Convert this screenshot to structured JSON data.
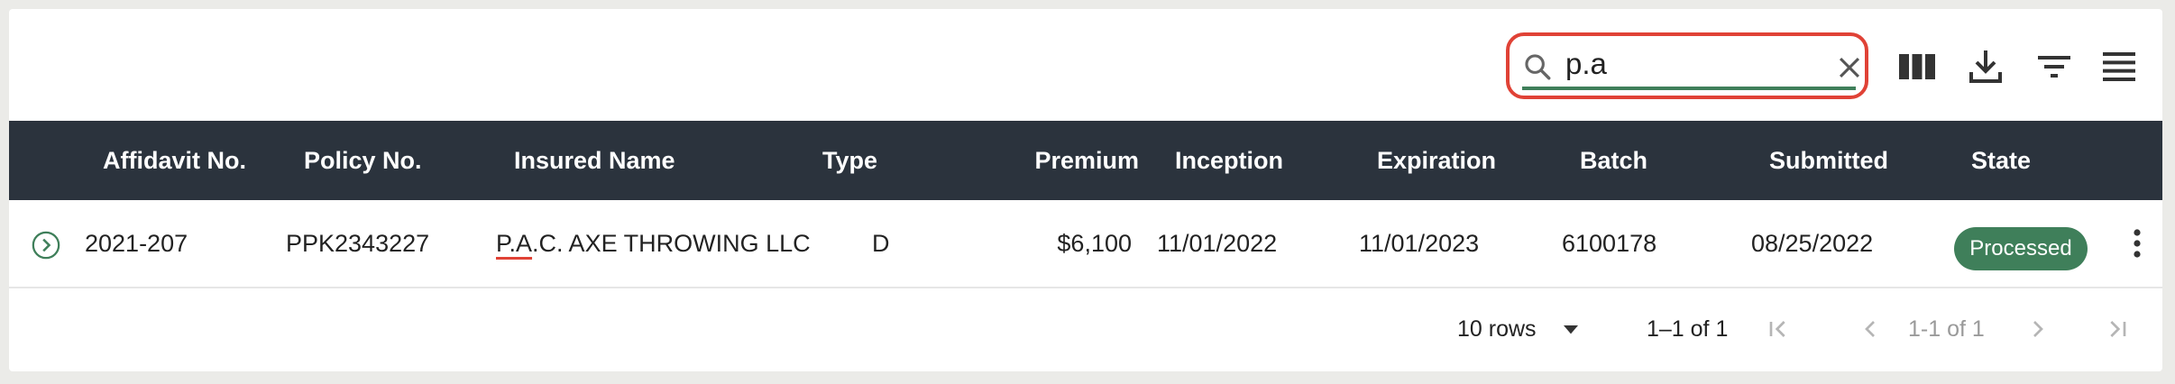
{
  "toolbar": {
    "search_value": "p.a",
    "search_icon": "search-icon",
    "clear_icon": "close-icon",
    "columns_icon": "columns-icon",
    "download_icon": "download-icon",
    "filter_icon": "filter-icon",
    "density_icon": "density-icon"
  },
  "table": {
    "headers": [
      "Affidavit No.",
      "Policy No.",
      "Insured Name",
      "Type",
      "Premium",
      "Inception",
      "Expiration",
      "Batch",
      "Submitted",
      "State"
    ],
    "rows": [
      {
        "affidavit": "2021-207",
        "policy": "PPK2343227",
        "insured_match": "P.A",
        "insured_rest": ".C. AXE THROWING LLC",
        "type": "D",
        "premium": "$6,100",
        "inception": "11/01/2022",
        "expiration": "11/01/2023",
        "batch": "6100178",
        "submitted": "08/25/2022",
        "state": "Processed"
      }
    ]
  },
  "footer": {
    "rows_per_page": "10 rows",
    "range": "1–1 of 1",
    "page_info": "1-1 of 1"
  },
  "colors": {
    "header_bg": "#2b333d",
    "accent_green": "#3f7f5a",
    "highlight_red": "#e04236"
  }
}
